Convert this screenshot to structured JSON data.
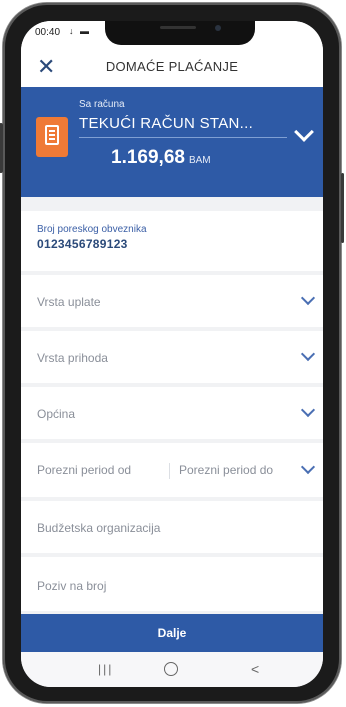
{
  "status_bar": {
    "time": "00:40",
    "icons": "↓ ▬"
  },
  "header": {
    "close_icon": "close-icon",
    "title": "DOMAĆE PLAĆANJE"
  },
  "account": {
    "from_label": "Sa računa",
    "name": "TEKUĆI RAČUN STAN...",
    "amount": "1.169,68",
    "currency": "BAM",
    "icon": "document-icon"
  },
  "tax_id": {
    "label": "Broj poreskog obveznika",
    "value": "0123456789123"
  },
  "fields": {
    "payment_type": "Vrsta uplate",
    "income_type": "Vrsta prihoda",
    "municipality": "Općina",
    "period_from": "Porezni period od",
    "period_to": "Porezni period do",
    "budget_org": "Budžetska organizacija",
    "reference": "Poziv na broj"
  },
  "submit_label": "Dalje",
  "nav": {
    "recent": "|||",
    "back": "<"
  },
  "colors": {
    "primary": "#2e5aa6",
    "accent": "#ef7a36",
    "background": "#f1f2f4"
  }
}
